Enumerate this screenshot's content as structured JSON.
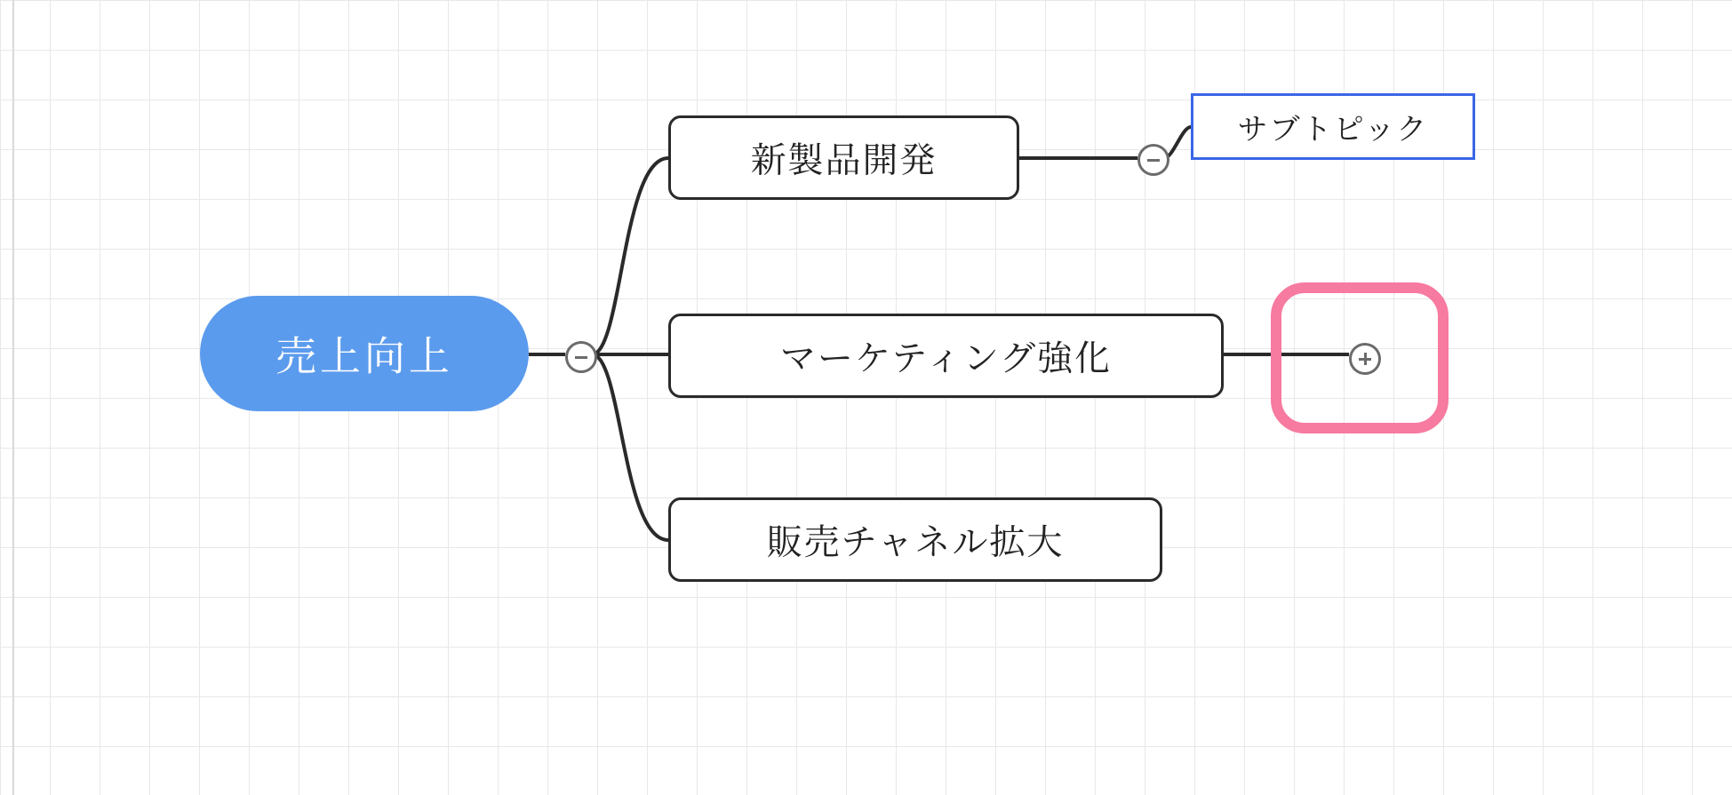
{
  "mindmap": {
    "root": {
      "label": "売上向上"
    },
    "branches": [
      {
        "label": "新製品開発",
        "sub": {
          "label": "サブトピック"
        }
      },
      {
        "label": "マーケティング強化"
      },
      {
        "label": "販売チャネル拡大"
      }
    ]
  },
  "toggles": {
    "root_symbol": "−",
    "branch1_symbol": "−",
    "branch2_symbol": "+"
  }
}
